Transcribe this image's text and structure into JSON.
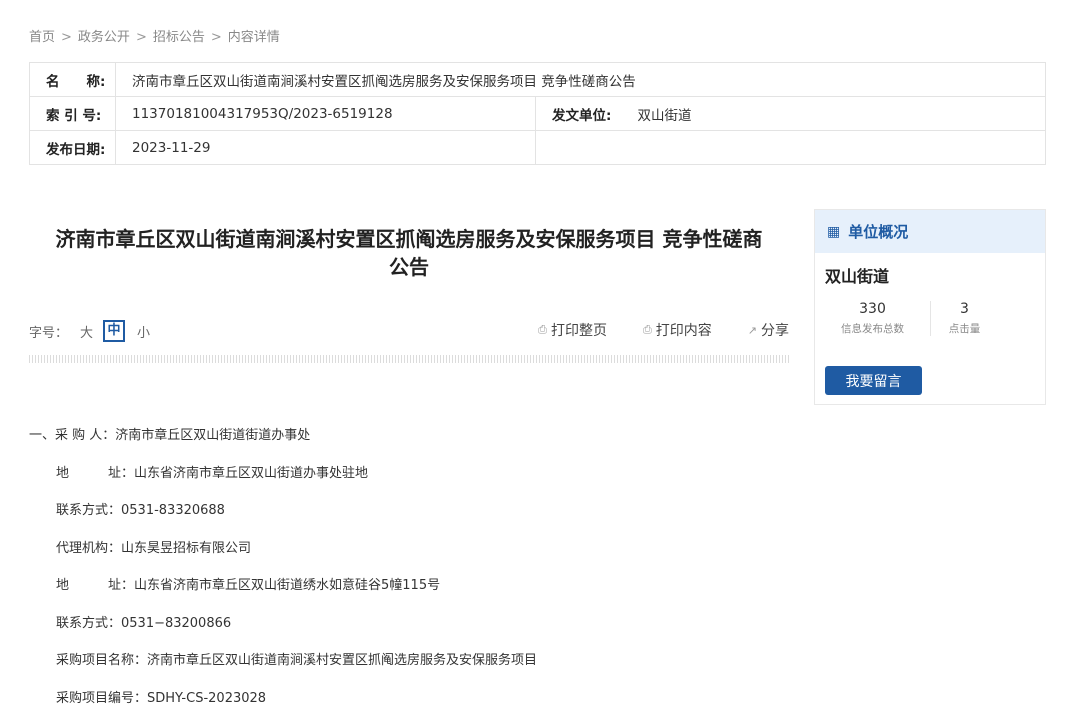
{
  "breadcrumb": {
    "items": [
      "首页",
      "政务公开",
      "招标公告",
      "内容详情"
    ],
    "separator": ">"
  },
  "meta": {
    "name_label": "名　　称:",
    "name_value": "济南市章丘区双山街道南涧溪村安置区抓阄选房服务及安保服务项目 竞争性磋商公告",
    "index_label": "索 引 号:",
    "index_value": "11370181004317953Q/2023-6519128",
    "issuer_label": "发文单位:",
    "issuer_value": "双山街道",
    "date_label": "发布日期:",
    "date_value": "2023-11-29"
  },
  "article": {
    "title_line1": "济南市章丘区双山街道南涧溪村安置区抓阄选房服务及安保服务项目 竞争性磋商",
    "title_line2": "公告"
  },
  "toolbar": {
    "fontsize_label": "字号：",
    "font_large": "大",
    "font_medium": "中",
    "font_small": "小",
    "print_page": "打印整页",
    "print_content": "打印内容",
    "share": "分享"
  },
  "content": {
    "lines": [
      "一、采 购 人：济南市章丘区双山街道街道办事处",
      "地　　　址：山东省济南市章丘区双山街道办事处驻地",
      "联系方式：0531-83320688",
      "代理机构：山东昊昱招标有限公司",
      "地　　　址：山东省济南市章丘区双山街道绣水如意硅谷5幢115号",
      "联系方式：0531−83200866",
      "采购项目名称：济南市章丘区双山街道南涧溪村安置区抓阄选房服务及安保服务项目",
      "采购项目编号：SDHY-CS-2023028"
    ]
  },
  "sidebar": {
    "title": "单位概况",
    "org_name": "双山街道",
    "stats": [
      {
        "value": "330",
        "label": "信息发布总数"
      },
      {
        "value": "3",
        "label": "点击量"
      }
    ],
    "message_button": "我要留言"
  },
  "colors": {
    "accent": "#1f5ba3",
    "sidebar_header_bg": "#e6f0fb"
  }
}
